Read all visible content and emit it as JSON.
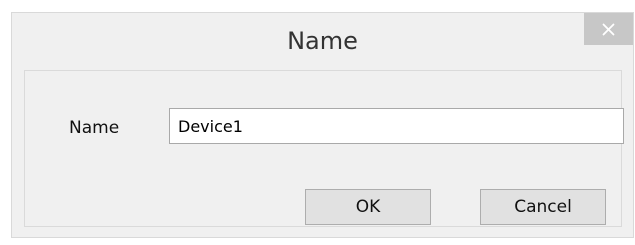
{
  "dialog": {
    "title": "Name",
    "close_icon": "close-icon",
    "field_label": "Name",
    "name_value": "Device1",
    "ok_label": "OK",
    "cancel_label": "Cancel"
  },
  "colors": {
    "dialog_background": "#f0f0f0",
    "close_button_background": "#c7c7c7",
    "button_background": "#e1e1e1",
    "input_border": "#a9a9a9"
  }
}
